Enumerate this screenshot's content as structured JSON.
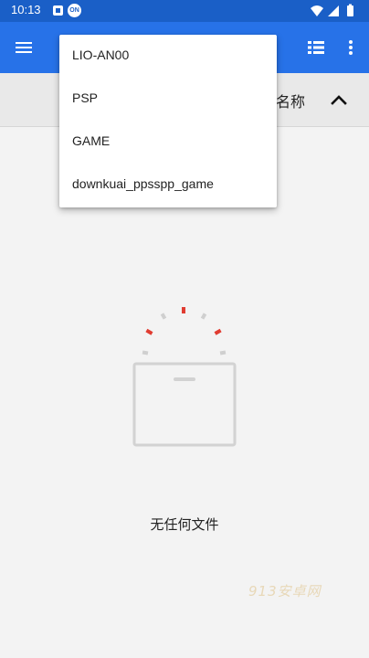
{
  "status_bar": {
    "time": "10:13",
    "on_badge": "ON",
    "icons": [
      "notification-a-icon",
      "on-badge-icon",
      "wifi-icon",
      "signal-icon",
      "battery-icon"
    ]
  },
  "app_bar": {
    "color": "#2772e8",
    "icons": [
      "hamburger-menu-icon",
      "list-view-icon",
      "more-vert-icon"
    ]
  },
  "sort_header": {
    "label": "名称",
    "direction_icon": "chevron-up-icon"
  },
  "dropdown": {
    "items": [
      {
        "label": "LIO-AN00"
      },
      {
        "label": "PSP"
      },
      {
        "label": "GAME"
      },
      {
        "label": "downkuai_ppsspp_game"
      }
    ]
  },
  "empty_state": {
    "message": "无任何文件",
    "accent_color": "#e03c31",
    "icon": "empty-box-icon"
  },
  "watermark": {
    "text": "913安卓网"
  }
}
